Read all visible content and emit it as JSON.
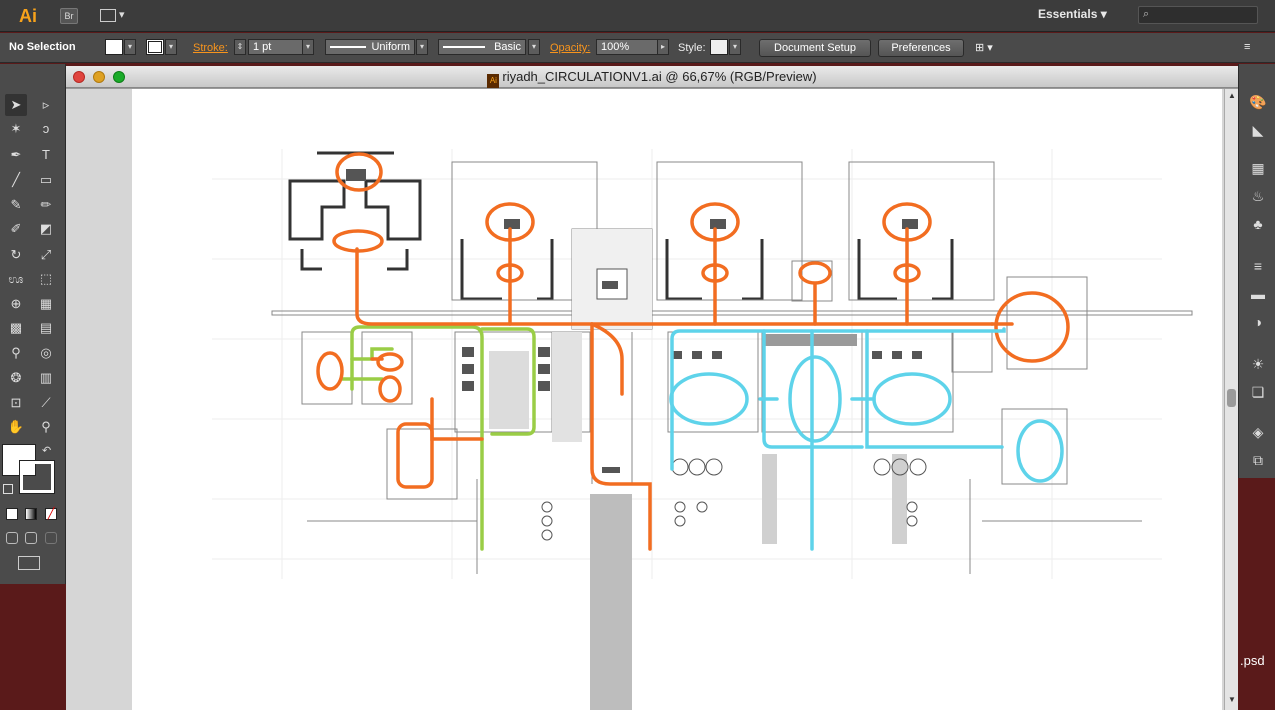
{
  "appbar": {
    "logo": "Ai",
    "bridge_label": "Br",
    "workspace": "Essentials",
    "search_placeholder": ""
  },
  "controlbar": {
    "selection": "No Selection",
    "stroke_label": "Stroke:",
    "stroke_weight": "1 pt",
    "profile": "Uniform",
    "brush": "Basic",
    "opacity_label": "Opacity:",
    "opacity_value": "100%",
    "style_label": "Style:",
    "document_setup": "Document Setup",
    "preferences": "Preferences"
  },
  "document": {
    "title": "riyadh_CIRCULATIONV1.ai @ 66,67% (RGB/Preview)",
    "icon": "Ai"
  },
  "tools": [
    "selection-tool",
    "direct-selection-tool",
    "magic-wand-tool",
    "lasso-tool",
    "pen-tool",
    "type-tool",
    "line-tool",
    "rectangle-tool",
    "paintbrush-tool",
    "pencil-tool",
    "blob-brush-tool",
    "eraser-tool",
    "rotate-tool",
    "scale-tool",
    "warp-tool",
    "free-transform-tool",
    "shape-builder-tool",
    "perspective-grid-tool",
    "mesh-tool",
    "gradient-tool",
    "eyedropper-tool",
    "blend-tool",
    "symbol-sprayer-tool",
    "column-graph-tool",
    "artboard-tool",
    "slice-tool",
    "hand-tool",
    "zoom-tool"
  ],
  "dock": [
    "color-guide-panel",
    "gradient-panel",
    "swatches-panel",
    "brushes-panel",
    "symbols-panel",
    "stroke-panel",
    "transparency-panel",
    "appearance-panel",
    "graphic-styles-panel",
    "layers-panel",
    "artboards-panel"
  ],
  "desktop": {
    "file_label": ".psd"
  },
  "colors": {
    "orange_circulation": "#f26d21",
    "green_circulation": "#9acd46",
    "blue_circulation": "#5ed3ea"
  }
}
